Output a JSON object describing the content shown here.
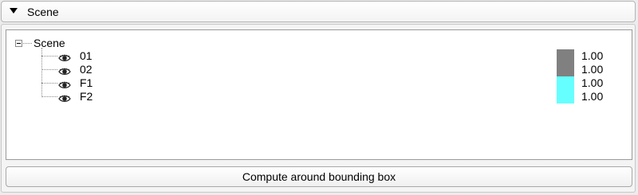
{
  "panel": {
    "title": "Scene"
  },
  "tree": {
    "root_label": "Scene",
    "items": [
      {
        "label": "01",
        "value": "1.00",
        "color": "#808080",
        "icon": "eye-icon"
      },
      {
        "label": "02",
        "value": "1.00",
        "color": "#808080",
        "icon": "eye-icon"
      },
      {
        "label": "F1",
        "value": "1.00",
        "color": "#66ffff",
        "icon": "eye-icon"
      },
      {
        "label": "F2",
        "value": "1.00",
        "color": "#66ffff",
        "icon": "eye-icon"
      }
    ]
  },
  "actions": {
    "compute_label": "Compute around bounding box"
  }
}
